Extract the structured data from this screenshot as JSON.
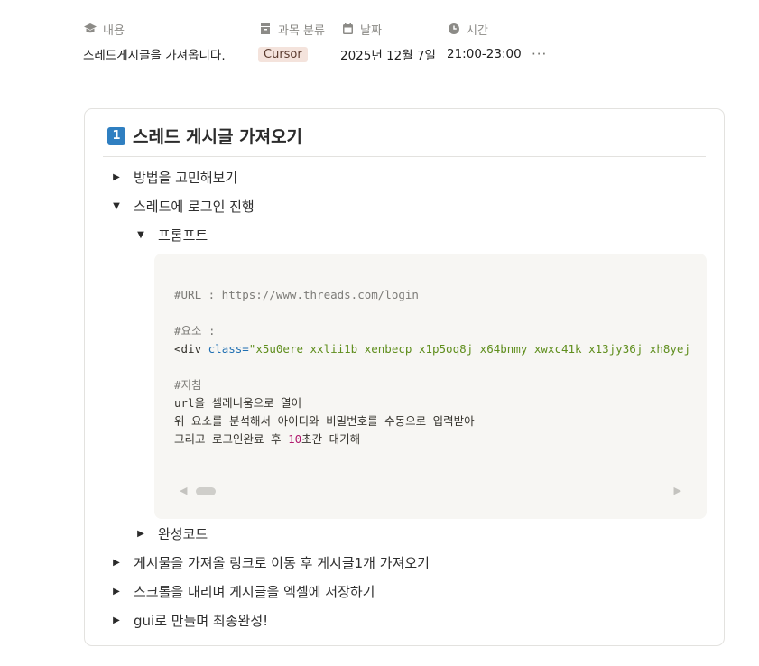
{
  "properties": {
    "content": {
      "label": "내용",
      "icon": "graduation-cap-icon",
      "value": "스레드게시글을 가져옵니다."
    },
    "subject": {
      "label": "과목 분류",
      "icon": "archive-icon",
      "value": "Cursor",
      "tag_color": "#f4e3dc"
    },
    "date": {
      "label": "날짜",
      "icon": "calendar-icon",
      "value": "2025년 12월 7일"
    },
    "time": {
      "label": "시간",
      "icon": "clock-icon",
      "value": "21:00-23:00"
    },
    "more": "···"
  },
  "callout": {
    "number": "1",
    "title": "스레드 게시글 가져오기",
    "accent": "#2f7fc1",
    "toggles": [
      {
        "label": "방법을 고민해보기",
        "state": "collapsed"
      },
      {
        "label": "스레드에 로그인 진행",
        "state": "expanded"
      },
      {
        "label": "프롬프트",
        "state": "expanded"
      },
      {
        "label": "완성코드",
        "state": "collapsed"
      },
      {
        "label": "게시물을 가져올 링크로 이동 후 게시글1개 가져오기",
        "state": "collapsed"
      },
      {
        "label": "스크롤을 내리며 게시글을 엑셀에 저장하기",
        "state": "collapsed"
      },
      {
        "label": "gui로 만들며 최종완성!",
        "state": "collapsed"
      }
    ],
    "code": {
      "line1": "#URL : https://www.threads.com/login",
      "line2": "#요소 :",
      "div_open": "<div ",
      "div_attr": "class=",
      "div_value": "\"x5u0ere xxlii1b xenbecp x1p5oq8j x64bnmy xwxc41k x13jy36j xh8yej",
      "line3": "#지침",
      "line4": "url을 셀레니움으로 열어",
      "line5": "위 요소를 분석해서 아이디와 비밀번호를 수동으로 입력받아",
      "line6_a": "그리고 로그인완료 후 ",
      "line6_num": "10",
      "line6_b": "초간 대기해"
    }
  }
}
